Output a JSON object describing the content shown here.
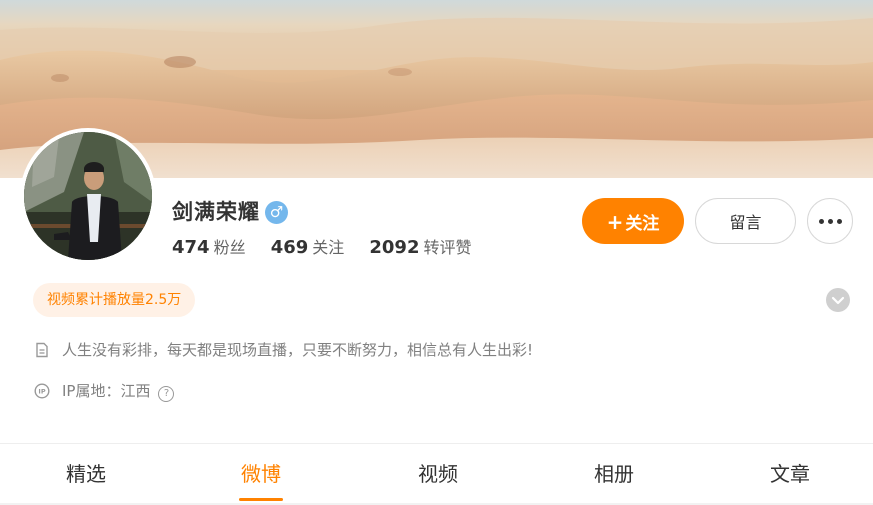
{
  "profile": {
    "name": "剑满荣耀",
    "gender_symbol": "♂",
    "stats": [
      {
        "num": "474",
        "label": "粉丝"
      },
      {
        "num": "469",
        "label": "关注"
      },
      {
        "num": "2092",
        "label": "转评赞"
      }
    ],
    "badge": "视频累计播放量2.5万",
    "description": "人生没有彩排，每天都是现场直播，只要不断努力，相信总有人生出彩!",
    "ip_label": "IP属地：江西",
    "help_symbol": "?"
  },
  "actions": {
    "follow_plus": "+",
    "follow_label": "关注",
    "message_label": "留言"
  },
  "tabs": [
    {
      "label": "精选"
    },
    {
      "label": "微博"
    },
    {
      "label": "视频"
    },
    {
      "label": "相册"
    },
    {
      "label": "文章"
    }
  ],
  "active_tab": "微博",
  "colors": {
    "accent": "#ff8200",
    "gender_badge": "#74b7ec",
    "badge_bg": "#fff1e6",
    "muted_text": "#808080"
  },
  "icons": {
    "gender": "male-icon",
    "more": "more-dots-icon",
    "expand": "chevron-down-icon",
    "description": "document-icon",
    "ip": "ip-location-icon",
    "help": "help-icon"
  }
}
